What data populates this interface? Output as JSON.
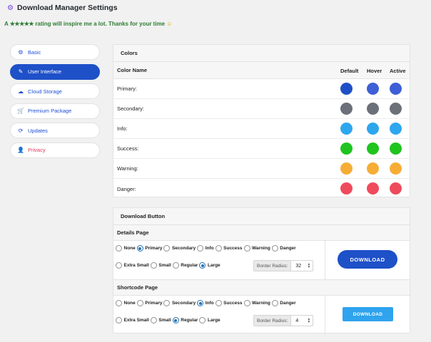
{
  "header": {
    "title": "Download Manager Settings",
    "icon": "gears-icon"
  },
  "rating": {
    "prefix": "A",
    "stars": "★★★★★",
    "text": "rating will inspire me a lot. Thanks for your time",
    "emoji": "☺"
  },
  "sidebar": {
    "items": [
      {
        "label": "Basic",
        "icon": "⚙",
        "active": false
      },
      {
        "label": "User Interface",
        "icon": "✎",
        "active": true
      },
      {
        "label": "Cloud Storage",
        "icon": "☁",
        "active": false
      },
      {
        "label": "Premium Package",
        "icon": "🛒",
        "active": false
      },
      {
        "label": "Updates",
        "icon": "⟳",
        "active": false
      },
      {
        "label": "Privacy",
        "icon": "👤",
        "active": false
      }
    ]
  },
  "colors": {
    "title": "Colors",
    "headers": {
      "name": "Color Name",
      "default": "Default",
      "hover": "Hover",
      "active": "Active"
    },
    "rows": [
      {
        "name": "Primary:",
        "default": "#1e4fc7",
        "hover": "#3e5fd6",
        "active": "#3e5fd6"
      },
      {
        "name": "Secondary:",
        "default": "#6b7079",
        "hover": "#6b7079",
        "active": "#6b7079"
      },
      {
        "name": "Info:",
        "default": "#2ea6ee",
        "hover": "#2ea6ee",
        "active": "#2ea6ee"
      },
      {
        "name": "Success:",
        "default": "#1fc41f",
        "hover": "#1fc41f",
        "active": "#1fc41f"
      },
      {
        "name": "Warning:",
        "default": "#f6ad36",
        "hover": "#f6ad36",
        "active": "#f6ad36"
      },
      {
        "name": "Danger:",
        "default": "#ef4b5c",
        "hover": "#ef4b5c",
        "active": "#ef4b5c"
      }
    ]
  },
  "download_button": {
    "title": "Download Button",
    "details_page": {
      "label": "Details Page",
      "styles": [
        "None",
        "Primary",
        "Secondary",
        "Info",
        "Success",
        "Warning",
        "Danger"
      ],
      "selected_style": "Primary",
      "sizes": [
        "Extra Small",
        "Small",
        "Regular",
        "Large"
      ],
      "selected_size": "Large",
      "border_radius_label": "Border Radius:",
      "border_radius": "32",
      "preview_label": "DOWNLOAD"
    },
    "shortcode_page": {
      "label": "Shortcode Page",
      "styles": [
        "None",
        "Primary",
        "Secondary",
        "Info",
        "Success",
        "Warning",
        "Danger"
      ],
      "selected_style": "Info",
      "sizes": [
        "Extra Small",
        "Small",
        "Regular",
        "Large"
      ],
      "selected_size": "Regular",
      "border_radius_label": "Border Radius:",
      "border_radius": "4",
      "preview_label": "DOWNLOAD"
    }
  }
}
